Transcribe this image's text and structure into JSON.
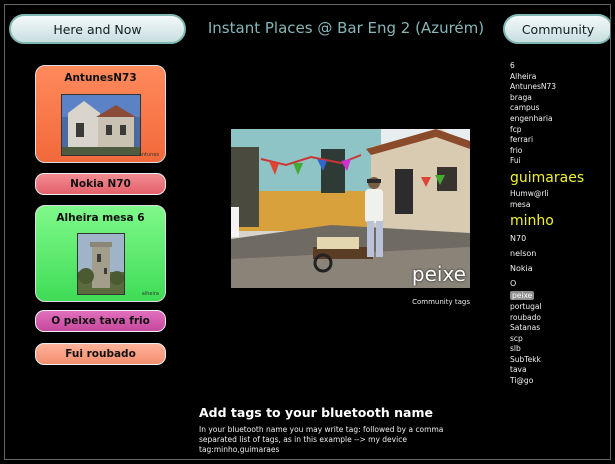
{
  "header": {
    "left_tab": "Here and Now",
    "title": "Instant Places @ Bar Eng 2 (Azurém)",
    "right_tab": "Community"
  },
  "left_column": {
    "card_1": {
      "caption": "AntunesN73",
      "photo_credit": "antunes"
    },
    "button_1": "Nokia N70",
    "card_2": {
      "caption": "Alheira mesa 6",
      "photo_credit": "alheira"
    },
    "button_2": "O peixe tava frio",
    "button_3": "Fui roubado"
  },
  "center": {
    "photo_tag": "peixe",
    "caption": "Community tags",
    "add_title": "Add tags to your bluetooth name",
    "add_body": "In your bluetooth name you may write tag: followed by a comma separated list of tags, as in this example --> my device tag:minho,guimaraes"
  },
  "tags": [
    {
      "text": "6"
    },
    {
      "text": "Alheira"
    },
    {
      "text": "AntunesN73"
    },
    {
      "text": "braga"
    },
    {
      "text": "campus"
    },
    {
      "text": "engenharia"
    },
    {
      "text": "fcp"
    },
    {
      "text": "ferrari"
    },
    {
      "text": "frio"
    },
    {
      "text": "Fui"
    },
    {
      "text": "guimaraes",
      "size": "big"
    },
    {
      "text": "Humw@rli"
    },
    {
      "text": "mesa"
    },
    {
      "text": "minho",
      "size": "big"
    },
    {
      "text": "N70",
      "size": "mid"
    },
    {
      "text": "nelson",
      "size": "mid"
    },
    {
      "text": "Nokia",
      "size": "mid"
    },
    {
      "text": "O",
      "size": "mid"
    },
    {
      "text": "peixe",
      "highlight": true
    },
    {
      "text": "portugal"
    },
    {
      "text": "roubado"
    },
    {
      "text": "Satanas"
    },
    {
      "text": "scp"
    },
    {
      "text": "slb"
    },
    {
      "text": "SubTekk"
    },
    {
      "text": "tava"
    },
    {
      "text": "Ti@go"
    }
  ]
}
